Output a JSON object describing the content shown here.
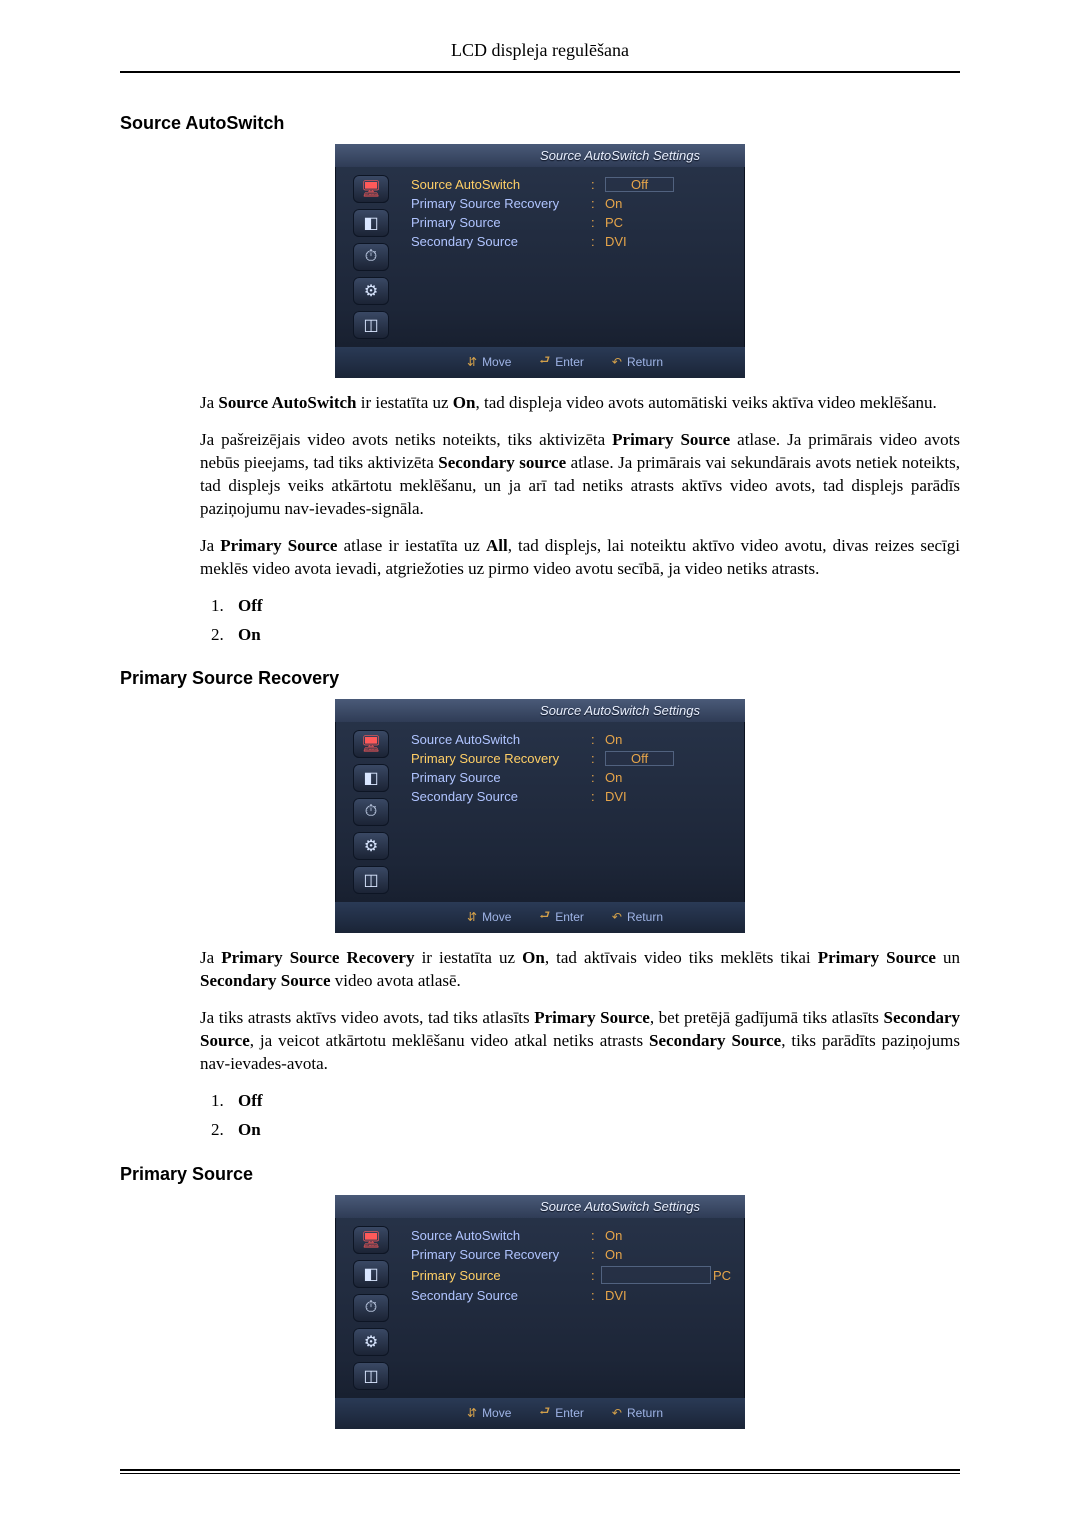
{
  "page_title": "LCD displeja regulēšana",
  "sections": {
    "autoswitch": {
      "heading": "Source AutoSwitch",
      "p1_pre": "Ja ",
      "p1_b1": "Source AutoSwitch",
      "p1_mid1": " ir iestatīta uz ",
      "p1_b2": "On",
      "p1_post": ", tad displeja video avots automātiski veiks aktīva video meklēšanu.",
      "p2_pre": "Ja pašreizējais video avots netiks noteikts, tiks aktivizēta ",
      "p2_b1": "Primary Source",
      "p2_mid1": " atlase. Ja primārais video avots nebūs pieejams, tad tiks aktivizēta ",
      "p2_b2": "Secondary source",
      "p2_post": " atlase. Ja primārais vai sekundārais avots netiek noteikts, tad displejs veiks atkārtotu meklēšanu, un ja arī tad netiks atrasts aktīvs video avots, tad displejs parādīs paziņojumu nav-ievades-signāla.",
      "p3_pre": "Ja ",
      "p3_b1": "Primary Source",
      "p3_mid1": " atlase ir iestatīta uz ",
      "p3_b2": "All",
      "p3_post": ", tad displejs, lai noteiktu aktīvo video avotu, divas reizes secīgi meklēs video avota ievadi, atgriežoties uz pirmo video avotu secībā, ja video netiks atrasts.",
      "list": [
        "Off",
        "On"
      ]
    },
    "recovery": {
      "heading": "Primary Source Recovery",
      "p1_pre": "Ja ",
      "p1_b1": "Primary Source Recovery",
      "p1_mid1": " ir iestatīta uz ",
      "p1_b2": "On",
      "p1_mid2": ", tad aktīvais video tiks meklēts tikai ",
      "p1_b3": "Primary Source",
      "p1_mid3": " un ",
      "p1_b4": "Secondary Source",
      "p1_post": " video avota atlasē.",
      "p2_pre": "Ja tiks atrasts aktīvs video avots, tad tiks atlasīts ",
      "p2_b1": "Primary Source",
      "p2_mid1": ", bet pretējā gadījumā tiks atlasīts ",
      "p2_b2": "Secondary Source",
      "p2_mid2": ", ja veicot atkārtotu meklēšanu video atkal netiks atrasts ",
      "p2_b3": "Secondary Source",
      "p2_post": ", tiks parādīts paziņojums nav-ievades-avota.",
      "list": [
        "Off",
        "On"
      ]
    },
    "primary": {
      "heading": "Primary Source"
    }
  },
  "osd": {
    "title": "Source AutoSwitch Settings",
    "labels": {
      "autoswitch": "Source AutoSwitch",
      "recovery": "Primary Source Recovery",
      "primary": "Primary Source",
      "secondary": "Secondary Source"
    },
    "footer": {
      "move": "Move",
      "enter": "Enter",
      "return": "Return"
    },
    "menu1": {
      "autoswitch_val": "Off",
      "recovery_val": "On",
      "primary_val": "PC",
      "secondary_val": "DVI",
      "highlight": "autoswitch"
    },
    "menu2": {
      "autoswitch_val": "On",
      "recovery_val": "Off",
      "primary_val": "On",
      "secondary_val": "DVI",
      "highlight": "recovery"
    },
    "menu3": {
      "autoswitch_val": "On",
      "recovery_val": "On",
      "primary_val": "PC",
      "secondary_val": "DVI",
      "highlight": "primary"
    }
  },
  "icons": {
    "monitor": "🖥",
    "input": "◧",
    "clock": "⏱",
    "gear": "⚙",
    "bars": "◫",
    "updown": "⇵",
    "enter": "⮐",
    "ret": "↶"
  }
}
